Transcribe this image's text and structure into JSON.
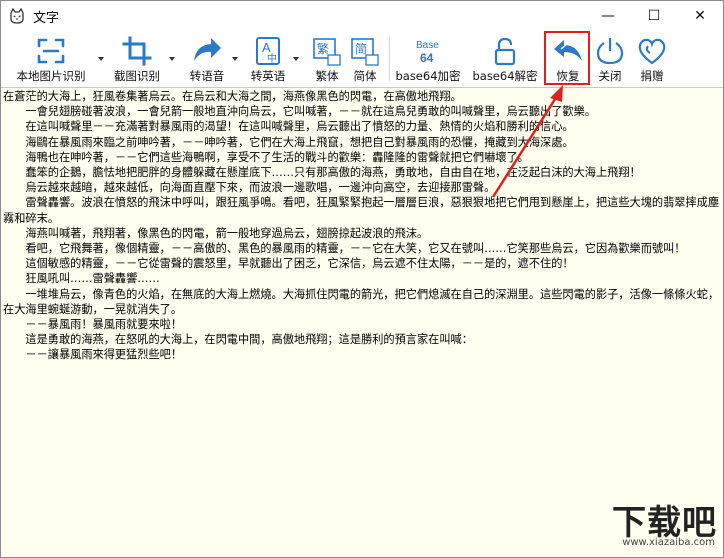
{
  "window": {
    "title": "文字",
    "controls": {
      "minimize": "—",
      "maximize": "☐",
      "close": "✕"
    }
  },
  "toolbar": {
    "local_ocr": "本地图片识别",
    "screenshot_ocr": "截图识别",
    "to_speech": "转语音",
    "to_english": "转英语",
    "traditional": "繁体",
    "simplified": "简体",
    "base64_encode": "base64加密",
    "base64_decode": "base64解密",
    "restore": "恢复",
    "close": "关闭",
    "donate": "捐赠",
    "icon_text": {
      "trad_char": "繁",
      "simp_char": "简",
      "base64_top": "Base",
      "base64_bottom": "64",
      "en_a": "A",
      "en_zhong": "中"
    }
  },
  "document": {
    "paragraphs": [
      "在蒼茫的大海上，狂風卷集著烏云。在烏云和大海之間，海燕像黑色的閃電，在高傲地飛翔。",
      "　　一會兒翅膀碰著波浪，一會兒箭一般地直沖向烏云，它叫喊著，－－就在這鳥兒勇敢的叫喊聲里，烏云聽出了歡樂。",
      "　　在這叫喊聲里－－充滿著對暴風雨的渴望！在這叫喊聲里，烏云聽出了憤怒的力量、熱情的火焰和勝利的信心。",
      "　　海鷗在暴風雨來臨之前呻吟著，－－呻吟著，它們在大海上飛竄，想把自己對暴風雨的恐懼，掩藏到大海深處。",
      "　　海鴨也在呻吟著，－－它們這些海鴨啊，享受不了生活的戰斗的歡樂：轟隆隆的雷聲就把它們嚇壞了。",
      "　　蠢笨的企鵝，膽怯地把肥胖的身體躲藏在懸崖底下……只有那高傲的海燕，勇敢地，自由自在地，在泛起白沫的大海上飛翔！",
      "　　烏云越來越暗，越來越低，向海面直壓下來，而波浪一邊歌唱，一邊沖向高空，去迎接那雷聲。",
      "　　雷聲轟響。波浪在憤怒的飛沫中呼叫，跟狂風爭鳴。看吧，狂風緊緊抱起一層層巨浪，惡狠狠地把它們甩到懸崖上，把這些大塊的翡翠摔成塵霧和碎末。",
      "　　海燕叫喊著，飛翔著，像黑色的閃電，箭一般地穿過烏云，翅膀掠起波浪的飛沫。",
      "　　看吧，它飛舞著，像個精靈，－－高傲的、黑色的暴風雨的精靈，－－它在大笑，它又在號叫……它笑那些烏云，它因為歡樂而號叫！",
      "　　這個敏感的精靈，－－它從雷聲的震怒里，早就聽出了困乏，它深信，烏云遮不住太陽，－－是的，遮不住的！",
      "　　狂風吼叫……雷聲轟響……",
      "　　一堆堆烏云，像青色的火焰，在無底的大海上燃燒。大海抓住閃電的箭光，把它們熄滅在自己的深淵里。這些閃電的影子，活像一條條火蛇，在大海里蜿蜒游動，一晃就消失了。",
      "　　－－暴風雨！暴風雨就要來啦！",
      "　　這是勇敢的海燕，在怒吼的大海上，在閃電中間，高傲地飛翔；這是勝利的預言家在叫喊：",
      "　　－－讓暴風雨來得更猛烈些吧！"
    ]
  },
  "watermark": {
    "brand": "下载吧",
    "url": "www.xiazaiba.com"
  },
  "colors": {
    "accent_blue": "#2b79c9",
    "highlight_red": "#e0201e",
    "content_bg": "#fffff0"
  }
}
